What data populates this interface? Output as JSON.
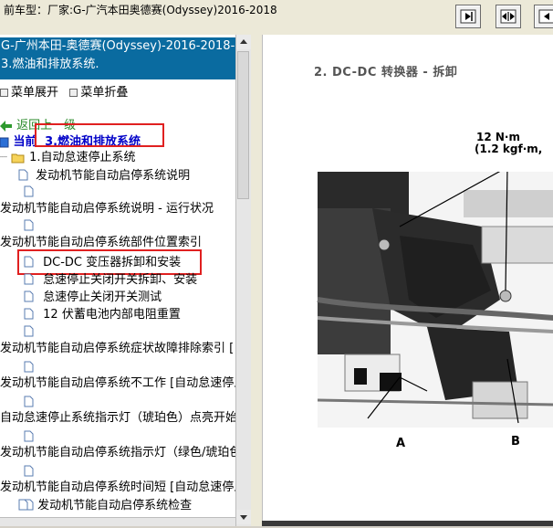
{
  "window": {
    "title": "前车型：厂家:G-广汽本田奥德赛(Odyssey)2016-2018"
  },
  "toolbar": {
    "buttons": [
      {
        "icon": "expand-right-icon"
      },
      {
        "icon": "expand-both-icon"
      },
      {
        "icon": "collapse-left-icon"
      }
    ]
  },
  "left": {
    "header_line1": "G-广州本田-奥德赛(Odyssey)-2016-2018-",
    "header_line2": "3.燃油和排放系统.",
    "menu_expand": "菜单展开",
    "menu_collapse": "菜单折叠",
    "back": "返回上一级",
    "current_prefix": "当前",
    "current_value": "3.燃油和排放系统",
    "tree": [
      {
        "label": "1.自动怠速停止系统",
        "type": "folder"
      },
      {
        "label": "发动机节能自动启停系统说明",
        "type": "doc"
      },
      {
        "label": "",
        "type": "doc"
      },
      {
        "label": "发动机节能自动启停系统说明 - 运行状况",
        "type": "text"
      },
      {
        "label": "",
        "type": "doc"
      },
      {
        "label": "发动机节能自动启停系统部件位置索引",
        "type": "text"
      },
      {
        "label": "DC-DC 变压器拆卸和安装",
        "type": "doc"
      },
      {
        "label": "怠速停止关闭开关拆卸、安装",
        "type": "doc"
      },
      {
        "label": "怠速停止关闭开关测试",
        "type": "doc"
      },
      {
        "label": "12 伏蓄电池内部电阻重置",
        "type": "doc"
      },
      {
        "label": "",
        "type": "doc"
      },
      {
        "label": "发动机节能自动启停系统症状故障排除索引 [自",
        "type": "text"
      },
      {
        "label": "",
        "type": "doc"
      },
      {
        "label": "发动机节能自动启停系统不工作 [自动怠速停止",
        "type": "text"
      },
      {
        "label": "",
        "type": "doc"
      },
      {
        "label": "自动怠速停止系统指示灯（琥珀色）点亮开始终",
        "type": "text"
      },
      {
        "label": "",
        "type": "doc"
      },
      {
        "label": "发动机节能自动启停系统指示灯（绿色/琥珀色",
        "type": "text"
      },
      {
        "label": "",
        "type": "doc"
      },
      {
        "label": "发动机节能自动启停系统时间短 [自动怠速停止",
        "type": "text"
      },
      {
        "label": "",
        "type": "doc"
      },
      {
        "label": "发动机节能自动启停系统检查",
        "type": "doc"
      }
    ]
  },
  "right": {
    "section_title": "2. DC-DC 转换器 - 拆卸",
    "torque_line1": "12 N·m",
    "torque_line2": "(1.2 kgf·m,",
    "callout_a": "A",
    "callout_b": "B"
  },
  "colors": {
    "header_bg": "#0a6ba0",
    "highlight_box": "#e02020",
    "current_text": "#0000c8",
    "back_text": "#2a8a2a"
  }
}
